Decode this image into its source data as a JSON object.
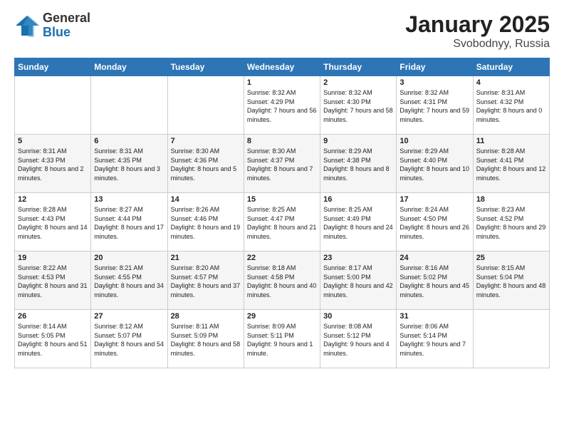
{
  "header": {
    "logo_general": "General",
    "logo_blue": "Blue",
    "title": "January 2025",
    "subtitle": "Svobodnyy, Russia"
  },
  "weekdays": [
    "Sunday",
    "Monday",
    "Tuesday",
    "Wednesday",
    "Thursday",
    "Friday",
    "Saturday"
  ],
  "weeks": [
    [
      {
        "day": null,
        "info": null
      },
      {
        "day": null,
        "info": null
      },
      {
        "day": null,
        "info": null
      },
      {
        "day": "1",
        "info": "Sunrise: 8:32 AM\nSunset: 4:29 PM\nDaylight: 7 hours\nand 56 minutes."
      },
      {
        "day": "2",
        "info": "Sunrise: 8:32 AM\nSunset: 4:30 PM\nDaylight: 7 hours\nand 58 minutes."
      },
      {
        "day": "3",
        "info": "Sunrise: 8:32 AM\nSunset: 4:31 PM\nDaylight: 7 hours\nand 59 minutes."
      },
      {
        "day": "4",
        "info": "Sunrise: 8:31 AM\nSunset: 4:32 PM\nDaylight: 8 hours\nand 0 minutes."
      }
    ],
    [
      {
        "day": "5",
        "info": "Sunrise: 8:31 AM\nSunset: 4:33 PM\nDaylight: 8 hours\nand 2 minutes."
      },
      {
        "day": "6",
        "info": "Sunrise: 8:31 AM\nSunset: 4:35 PM\nDaylight: 8 hours\nand 3 minutes."
      },
      {
        "day": "7",
        "info": "Sunrise: 8:30 AM\nSunset: 4:36 PM\nDaylight: 8 hours\nand 5 minutes."
      },
      {
        "day": "8",
        "info": "Sunrise: 8:30 AM\nSunset: 4:37 PM\nDaylight: 8 hours\nand 7 minutes."
      },
      {
        "day": "9",
        "info": "Sunrise: 8:29 AM\nSunset: 4:38 PM\nDaylight: 8 hours\nand 8 minutes."
      },
      {
        "day": "10",
        "info": "Sunrise: 8:29 AM\nSunset: 4:40 PM\nDaylight: 8 hours\nand 10 minutes."
      },
      {
        "day": "11",
        "info": "Sunrise: 8:28 AM\nSunset: 4:41 PM\nDaylight: 8 hours\nand 12 minutes."
      }
    ],
    [
      {
        "day": "12",
        "info": "Sunrise: 8:28 AM\nSunset: 4:43 PM\nDaylight: 8 hours\nand 14 minutes."
      },
      {
        "day": "13",
        "info": "Sunrise: 8:27 AM\nSunset: 4:44 PM\nDaylight: 8 hours\nand 17 minutes."
      },
      {
        "day": "14",
        "info": "Sunrise: 8:26 AM\nSunset: 4:46 PM\nDaylight: 8 hours\nand 19 minutes."
      },
      {
        "day": "15",
        "info": "Sunrise: 8:25 AM\nSunset: 4:47 PM\nDaylight: 8 hours\nand 21 minutes."
      },
      {
        "day": "16",
        "info": "Sunrise: 8:25 AM\nSunset: 4:49 PM\nDaylight: 8 hours\nand 24 minutes."
      },
      {
        "day": "17",
        "info": "Sunrise: 8:24 AM\nSunset: 4:50 PM\nDaylight: 8 hours\nand 26 minutes."
      },
      {
        "day": "18",
        "info": "Sunrise: 8:23 AM\nSunset: 4:52 PM\nDaylight: 8 hours\nand 29 minutes."
      }
    ],
    [
      {
        "day": "19",
        "info": "Sunrise: 8:22 AM\nSunset: 4:53 PM\nDaylight: 8 hours\nand 31 minutes."
      },
      {
        "day": "20",
        "info": "Sunrise: 8:21 AM\nSunset: 4:55 PM\nDaylight: 8 hours\nand 34 minutes."
      },
      {
        "day": "21",
        "info": "Sunrise: 8:20 AM\nSunset: 4:57 PM\nDaylight: 8 hours\nand 37 minutes."
      },
      {
        "day": "22",
        "info": "Sunrise: 8:18 AM\nSunset: 4:58 PM\nDaylight: 8 hours\nand 40 minutes."
      },
      {
        "day": "23",
        "info": "Sunrise: 8:17 AM\nSunset: 5:00 PM\nDaylight: 8 hours\nand 42 minutes."
      },
      {
        "day": "24",
        "info": "Sunrise: 8:16 AM\nSunset: 5:02 PM\nDaylight: 8 hours\nand 45 minutes."
      },
      {
        "day": "25",
        "info": "Sunrise: 8:15 AM\nSunset: 5:04 PM\nDaylight: 8 hours\nand 48 minutes."
      }
    ],
    [
      {
        "day": "26",
        "info": "Sunrise: 8:14 AM\nSunset: 5:05 PM\nDaylight: 8 hours\nand 51 minutes."
      },
      {
        "day": "27",
        "info": "Sunrise: 8:12 AM\nSunset: 5:07 PM\nDaylight: 8 hours\nand 54 minutes."
      },
      {
        "day": "28",
        "info": "Sunrise: 8:11 AM\nSunset: 5:09 PM\nDaylight: 8 hours\nand 58 minutes."
      },
      {
        "day": "29",
        "info": "Sunrise: 8:09 AM\nSunset: 5:11 PM\nDaylight: 9 hours\nand 1 minute."
      },
      {
        "day": "30",
        "info": "Sunrise: 8:08 AM\nSunset: 5:12 PM\nDaylight: 9 hours\nand 4 minutes."
      },
      {
        "day": "31",
        "info": "Sunrise: 8:06 AM\nSunset: 5:14 PM\nDaylight: 9 hours\nand 7 minutes."
      },
      {
        "day": null,
        "info": null
      }
    ]
  ]
}
